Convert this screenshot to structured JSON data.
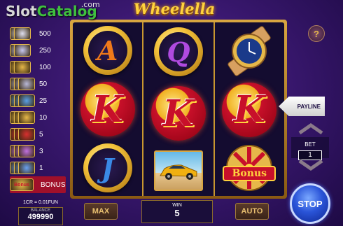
{
  "watermark": {
    "slot": "Slot",
    "catalog": "Catalog",
    "com": ".com"
  },
  "title": "Wheelella",
  "paytable": [
    {
      "value": "500",
      "color": "#e0e0f0",
      "count": 2
    },
    {
      "value": "250",
      "color": "#c8c8f0",
      "count": 2
    },
    {
      "value": "100",
      "color": "#e6b84a",
      "count": 2
    },
    {
      "value": "50",
      "color": "#b8b8d8",
      "count": 3
    },
    {
      "value": "25",
      "color": "#5aa0e6",
      "count": 3
    },
    {
      "value": "10",
      "color": "#e6b84a",
      "count": 3
    },
    {
      "value": "5",
      "color": "#d83030",
      "count": 3
    },
    {
      "value": "3",
      "color": "#c070e0",
      "count": 3
    },
    {
      "value": "1",
      "color": "#6aa0f0",
      "count": 3
    },
    {
      "value": "BONUS",
      "color": "#e6b84a",
      "count": 1,
      "label": "Bonus"
    }
  ],
  "reels": {
    "r1": {
      "top": "A",
      "bottom": "J"
    },
    "r2": {
      "top": "Q"
    },
    "k": "K",
    "bonus": "Bonus"
  },
  "payline_label": "PAYLINE",
  "help_label": "?",
  "bet": {
    "label": "BET",
    "value": "1"
  },
  "rate": "1CR = 0.01FUN",
  "balance": {
    "label": "BALANCE",
    "value": "499990"
  },
  "max_label": "MAX",
  "win": {
    "label": "WIN",
    "value": "5"
  },
  "auto_label": "AUTO",
  "stop_label": "STOP",
  "colors": {
    "gold": "#e6b84a",
    "red": "#c8102a",
    "blue": "#2a54d8"
  }
}
